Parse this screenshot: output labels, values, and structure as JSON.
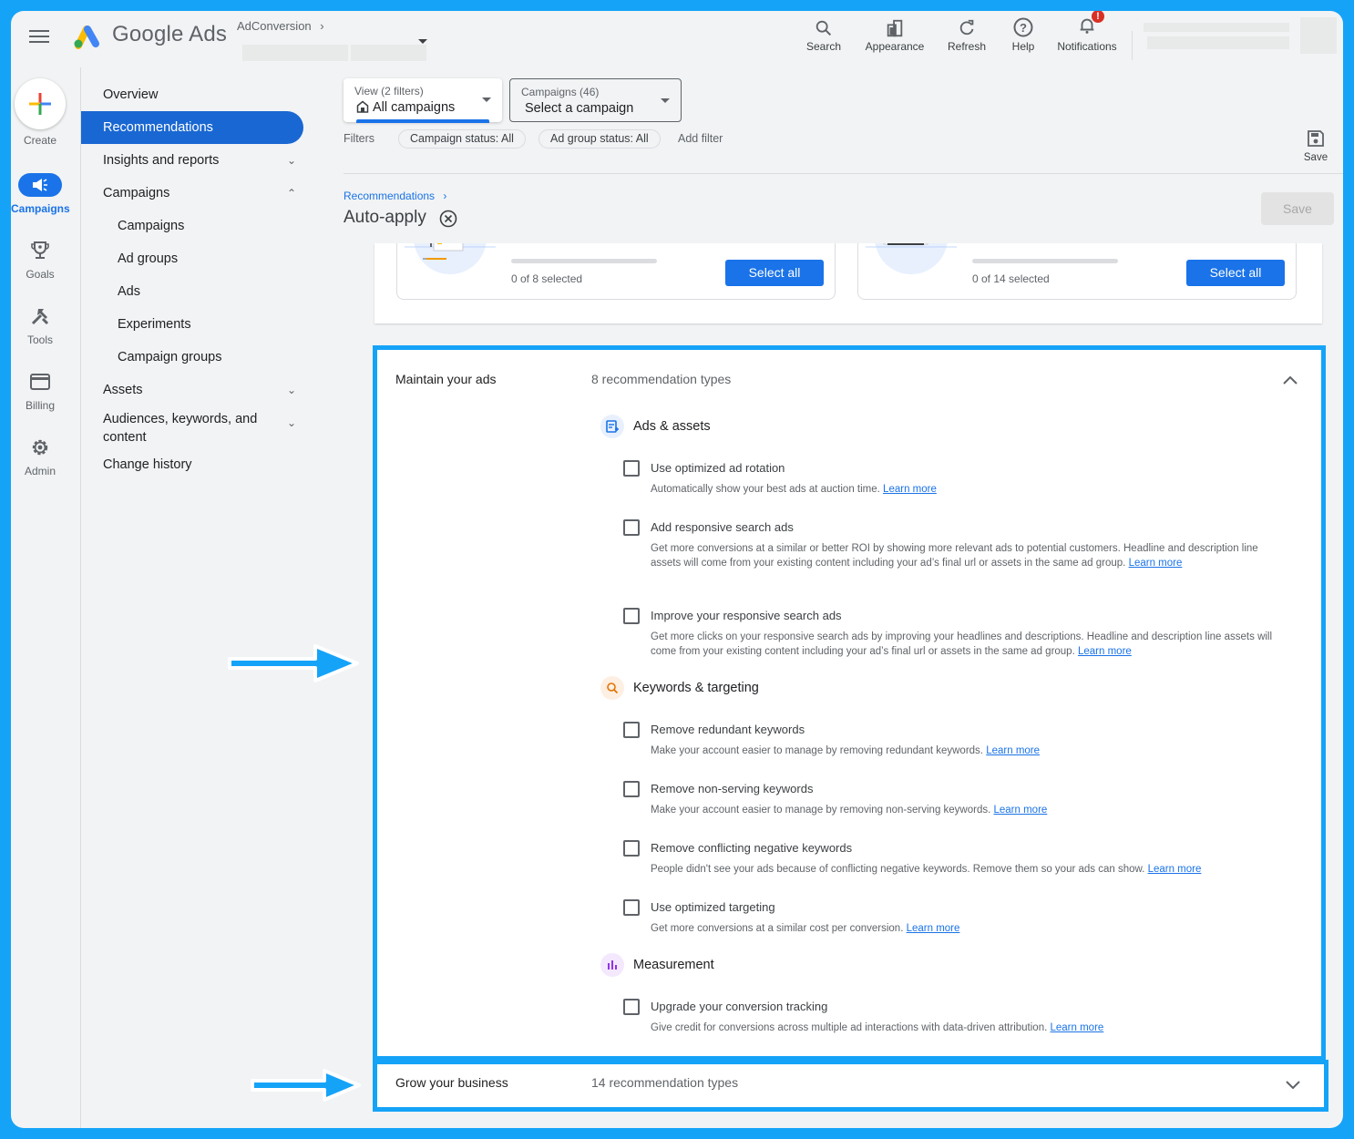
{
  "topbar": {
    "brand": "Google Ads",
    "account_name": "AdConversion",
    "tools": [
      {
        "label": "Search",
        "icon": "search-icon"
      },
      {
        "label": "Appearance",
        "icon": "appearance-icon"
      },
      {
        "label": "Refresh",
        "icon": "refresh-icon"
      },
      {
        "label": "Help",
        "icon": "help-icon"
      },
      {
        "label": "Notifications",
        "icon": "bell-icon",
        "badge": "!"
      }
    ]
  },
  "rail": {
    "create_label": "Create",
    "items": [
      {
        "label": "Campaigns",
        "icon": "campaigns-megaphone-icon",
        "active": true
      },
      {
        "label": "Goals",
        "icon": "trophy-icon"
      },
      {
        "label": "Tools",
        "icon": "tools-icon"
      },
      {
        "label": "Billing",
        "icon": "credit-card-icon"
      },
      {
        "label": "Admin",
        "icon": "gear-icon"
      }
    ]
  },
  "nav": {
    "items": [
      {
        "label": "Overview"
      },
      {
        "label": "Recommendations",
        "active": true
      },
      {
        "label": "Insights and reports",
        "chevron": "down"
      },
      {
        "label": "Campaigns",
        "chevron": "up"
      },
      {
        "label": "Campaigns",
        "sub": true
      },
      {
        "label": "Ad groups",
        "sub": true
      },
      {
        "label": "Ads",
        "sub": true
      },
      {
        "label": "Experiments",
        "sub": true
      },
      {
        "label": "Campaign groups",
        "sub": true
      },
      {
        "label": "Assets",
        "chevron": "down"
      },
      {
        "label": "Audiences, keywords, and content",
        "chevron": "down"
      },
      {
        "label": "Change history"
      }
    ]
  },
  "header": {
    "view_dropdown": {
      "label": "View (2 filters)",
      "value": "All campaigns"
    },
    "campaign_dropdown": {
      "label": "Campaigns (46)",
      "value": "Select a campaign"
    },
    "filters_label": "Filters",
    "filter_chips": [
      "Campaign status: All",
      "Ad group status: All"
    ],
    "add_filter": "Add filter",
    "save_label": "Save",
    "breadcrumb": "Recommendations",
    "page_title": "Auto-apply",
    "save_button": "Save"
  },
  "summary_cards": [
    {
      "count_text": "0 of 8 selected",
      "selected": 0,
      "total": 8,
      "button": "Select all"
    },
    {
      "count_text": "0 of 14 selected",
      "selected": 0,
      "total": 14,
      "button": "Select all"
    }
  ],
  "sections": {
    "maintain": {
      "title": "Maintain your ads",
      "count": "8 recommendation types",
      "expanded": true,
      "groups": [
        {
          "title": "Ads & assets",
          "icon": "ads-assets-icon",
          "color": "#1a73e8",
          "recs": [
            {
              "title": "Use optimized ad rotation",
              "desc": "Automatically show your best ads at auction time.",
              "link": "Learn more",
              "checked": false
            },
            {
              "title": "Add responsive search ads",
              "desc": "Get more conversions at a similar or better ROI by showing more relevant ads to potential customers. Headline and description line assets will come from your existing content including your ad’s final url or assets in the same ad group.",
              "link": "Learn more",
              "checked": false
            },
            {
              "title": "Improve your responsive search ads",
              "desc": "Get more clicks on your responsive search ads by improving your headlines and descriptions. Headline and description line assets will come from your existing content including your ad’s final url or assets in the same ad group.",
              "link": "Learn more",
              "checked": false
            }
          ]
        },
        {
          "title": "Keywords & targeting",
          "icon": "search-icon",
          "color": "#e37400",
          "recs": [
            {
              "title": "Remove redundant keywords",
              "desc": "Make your account easier to manage by removing redundant keywords.",
              "link": "Learn more",
              "checked": false
            },
            {
              "title": "Remove non-serving keywords",
              "desc": "Make your account easier to manage by removing non-serving keywords.",
              "link": "Learn more",
              "checked": false
            },
            {
              "title": "Remove conflicting negative keywords",
              "desc": "People didn't see your ads because of conflicting negative keywords. Remove them so your ads can show.",
              "link": "Learn more",
              "checked": false
            },
            {
              "title": "Use optimized targeting",
              "desc": "Get more conversions at a similar cost per conversion.",
              "link": "Learn more",
              "checked": false
            }
          ]
        },
        {
          "title": "Measurement",
          "icon": "bar-chart-icon",
          "color": "#9334e6",
          "recs": [
            {
              "title": "Upgrade your conversion tracking",
              "desc": "Give credit for conversions across multiple ad interactions with data-driven attribution.",
              "link": "Learn more",
              "checked": false
            }
          ]
        }
      ]
    },
    "grow": {
      "title": "Grow your business",
      "count": "14 recommendation types",
      "expanded": false
    }
  },
  "annotation_color": "#15a3f8"
}
